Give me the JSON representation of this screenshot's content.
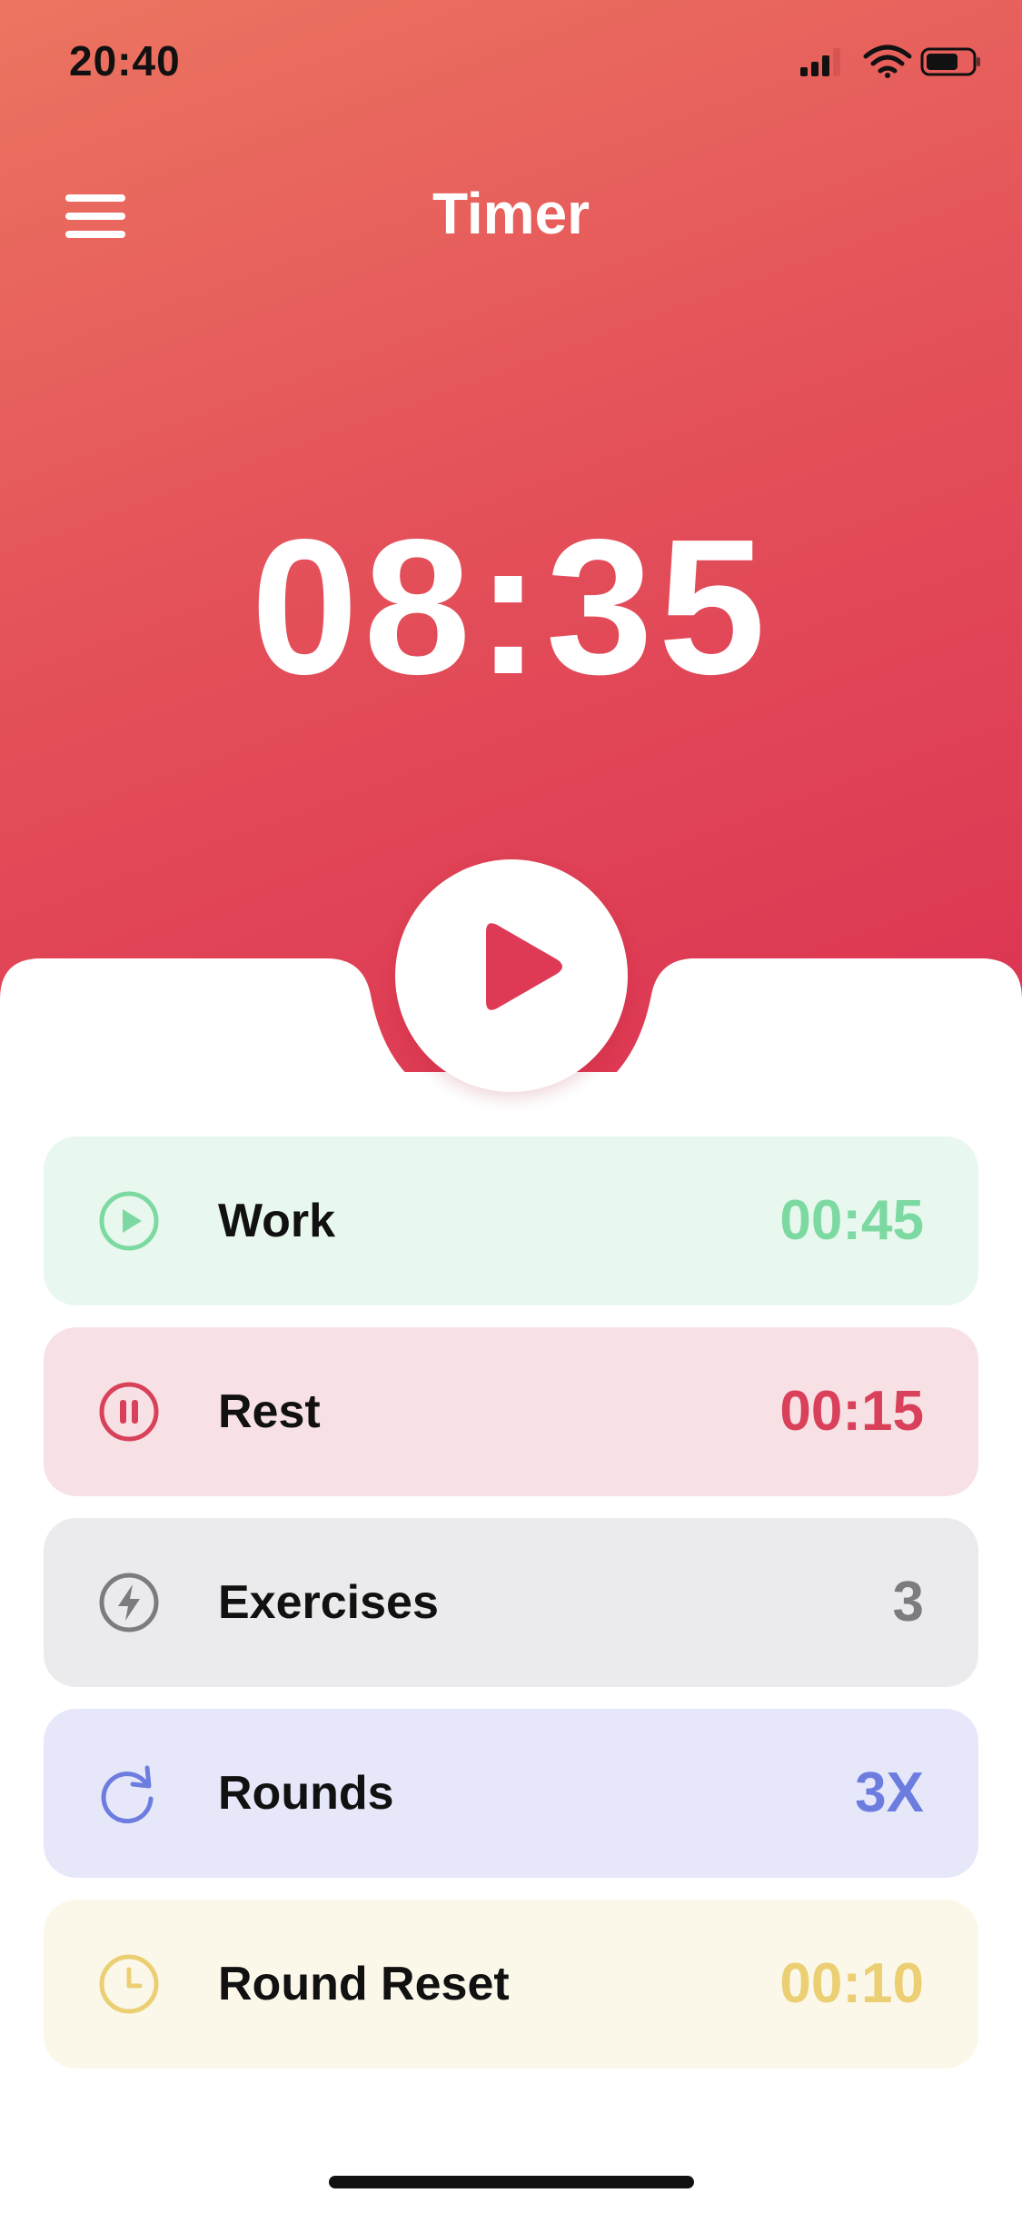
{
  "status_bar": {
    "time": "20:40"
  },
  "header": {
    "title": "Timer",
    "menu_icon": "hamburger-menu-icon"
  },
  "timer": {
    "display": "08:35",
    "action_icon": "play-icon"
  },
  "settings": [
    {
      "id": "work",
      "label": "Work",
      "value": "00:45",
      "icon": "play-circle-icon",
      "color": "#7dd9a2",
      "bg": "#e9f8ef"
    },
    {
      "id": "rest",
      "label": "Rest",
      "value": "00:15",
      "icon": "pause-circle-icon",
      "color": "#d9405a",
      "bg": "#f8e1e5"
    },
    {
      "id": "exercises",
      "label": "Exercises",
      "value": "3",
      "icon": "lightning-icon",
      "color": "#7c7c80",
      "bg": "#ebebed"
    },
    {
      "id": "rounds",
      "label": "Rounds",
      "value": "3X",
      "icon": "refresh-icon",
      "color": "#6d7ddf",
      "bg": "#e6e8fa"
    },
    {
      "id": "round-reset",
      "label": "Round Reset",
      "value": "00:10",
      "icon": "clock-icon",
      "color": "#ebcf72",
      "bg": "#fbf8ea"
    }
  ],
  "colors": {
    "hero_start": "#ec7560",
    "hero_end": "#dc3352",
    "accent": "#de3a55"
  }
}
